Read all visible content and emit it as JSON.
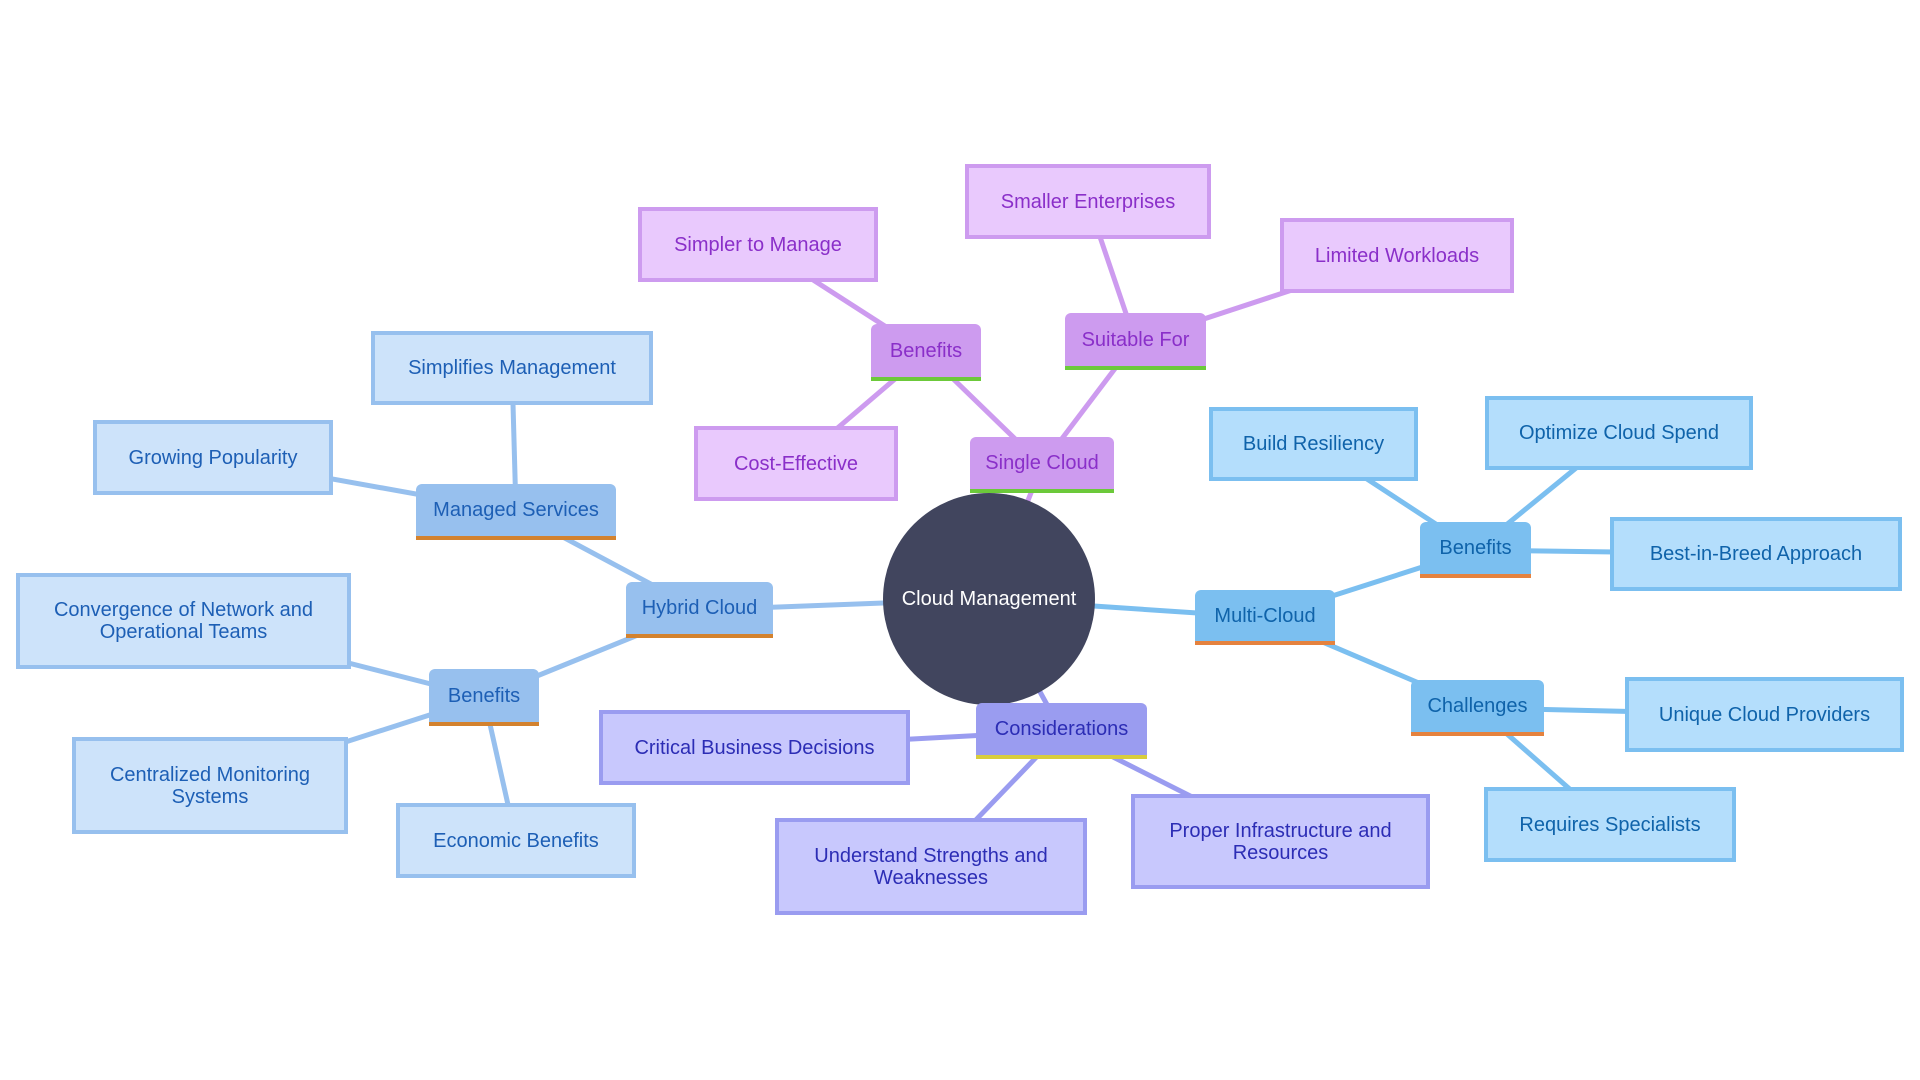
{
  "diagram": {
    "type": "mindmap",
    "root": {
      "id": "root",
      "label": "Cloud Management",
      "color": "#41455e"
    },
    "palettes": {
      "purple": {
        "branch_bg": "#cd9bef",
        "leaf_bg": "#e9c9fd",
        "text": "#8a2fc9",
        "accent": "#6cc93a",
        "edge": "#cd9bef"
      },
      "blue": {
        "branch_bg": "#97c0ee",
        "leaf_bg": "#cde3fa",
        "text": "#1d5fb5",
        "accent": "#d3822e",
        "edge": "#97c0ee"
      },
      "sky": {
        "branch_bg": "#7bbff0",
        "leaf_bg": "#b4defc",
        "text": "#0f63aa",
        "accent": "#e5823e",
        "edge": "#7bbff0"
      },
      "indigo": {
        "branch_bg": "#9a9cf0",
        "leaf_bg": "#c8c8fd",
        "text": "#2c2db5",
        "accent": "#d8cd3d",
        "edge": "#9a9cf0"
      }
    },
    "nodes": [
      {
        "id": "single-cloud",
        "label": "Single Cloud",
        "parent": "root",
        "kind": "branch",
        "palette": "purple"
      },
      {
        "id": "sc-benefits",
        "label": "Benefits",
        "parent": "single-cloud",
        "kind": "branch",
        "palette": "purple"
      },
      {
        "id": "sc-suitable",
        "label": "Suitable For",
        "parent": "single-cloud",
        "kind": "branch",
        "palette": "purple"
      },
      {
        "id": "sc-simpler",
        "label": "Simpler to Manage",
        "parent": "sc-benefits",
        "kind": "leaf",
        "palette": "purple"
      },
      {
        "id": "sc-cost",
        "label": "Cost-Effective",
        "parent": "sc-benefits",
        "kind": "leaf",
        "palette": "purple"
      },
      {
        "id": "sc-smaller",
        "label": "Smaller Enterprises",
        "parent": "sc-suitable",
        "kind": "leaf",
        "palette": "purple"
      },
      {
        "id": "sc-limited",
        "label": "Limited Workloads",
        "parent": "sc-suitable",
        "kind": "leaf",
        "palette": "purple"
      },
      {
        "id": "hybrid-cloud",
        "label": "Hybrid Cloud",
        "parent": "root",
        "kind": "branch",
        "palette": "blue"
      },
      {
        "id": "hc-managed",
        "label": "Managed Services",
        "parent": "hybrid-cloud",
        "kind": "branch",
        "palette": "blue"
      },
      {
        "id": "hc-benefits",
        "label": "Benefits",
        "parent": "hybrid-cloud",
        "kind": "branch",
        "palette": "blue"
      },
      {
        "id": "hc-simplifies",
        "label": "Simplifies Management",
        "parent": "hc-managed",
        "kind": "leaf",
        "palette": "blue"
      },
      {
        "id": "hc-growing",
        "label": "Growing Popularity",
        "parent": "hc-managed",
        "kind": "leaf",
        "palette": "blue"
      },
      {
        "id": "hc-convergence",
        "label": "Convergence of Network and Operational Teams",
        "parent": "hc-benefits",
        "kind": "leaf",
        "palette": "blue"
      },
      {
        "id": "hc-centralized",
        "label": "Centralized Monitoring Systems",
        "parent": "hc-benefits",
        "kind": "leaf",
        "palette": "blue"
      },
      {
        "id": "hc-economic",
        "label": "Economic Benefits",
        "parent": "hc-benefits",
        "kind": "leaf",
        "palette": "blue"
      },
      {
        "id": "considerations",
        "label": "Considerations",
        "parent": "root",
        "kind": "branch",
        "palette": "indigo"
      },
      {
        "id": "co-critical",
        "label": "Critical Business Decisions",
        "parent": "considerations",
        "kind": "leaf",
        "palette": "indigo"
      },
      {
        "id": "co-understand",
        "label": "Understand Strengths and Weaknesses",
        "parent": "considerations",
        "kind": "leaf",
        "palette": "indigo"
      },
      {
        "id": "co-proper",
        "label": "Proper Infrastructure and Resources",
        "parent": "considerations",
        "kind": "leaf",
        "palette": "indigo"
      },
      {
        "id": "multi-cloud",
        "label": "Multi-Cloud",
        "parent": "root",
        "kind": "branch",
        "palette": "sky"
      },
      {
        "id": "mc-benefits",
        "label": "Benefits",
        "parent": "multi-cloud",
        "kind": "branch",
        "palette": "sky"
      },
      {
        "id": "mc-challenges",
        "label": "Challenges",
        "parent": "multi-cloud",
        "kind": "branch",
        "palette": "sky"
      },
      {
        "id": "mc-resiliency",
        "label": "Build Resiliency",
        "parent": "mc-benefits",
        "kind": "leaf",
        "palette": "sky"
      },
      {
        "id": "mc-optimize",
        "label": "Optimize Cloud Spend",
        "parent": "mc-benefits",
        "kind": "leaf",
        "palette": "sky"
      },
      {
        "id": "mc-best",
        "label": "Best-in-Breed Approach",
        "parent": "mc-benefits",
        "kind": "leaf",
        "palette": "sky"
      },
      {
        "id": "mc-unique",
        "label": "Unique Cloud Providers",
        "parent": "mc-challenges",
        "kind": "leaf",
        "palette": "sky"
      },
      {
        "id": "mc-specialists",
        "label": "Requires Specialists",
        "parent": "mc-challenges",
        "kind": "leaf",
        "palette": "sky"
      }
    ]
  }
}
